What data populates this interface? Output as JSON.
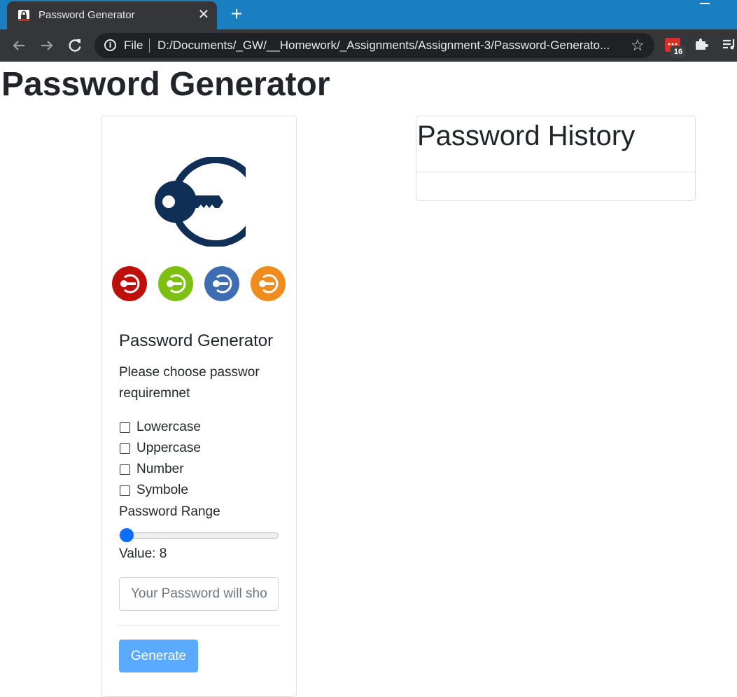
{
  "browser": {
    "tab_title": "Password Generator",
    "tab_close": "✕",
    "new_tab": "+",
    "scheme": "File",
    "url": "D:/Documents/_GW/__Homework/_Assignments/Assignment-3/Password-Generato...",
    "extension_badge": "16"
  },
  "page": {
    "title": "Password Generator"
  },
  "generator": {
    "heading": "Password Generator",
    "description": "Please choose passwor requiremnet",
    "options": [
      {
        "label": "Lowercase",
        "checked": false
      },
      {
        "label": "Uppercase",
        "checked": false
      },
      {
        "label": "Number",
        "checked": false
      },
      {
        "label": "Symbole",
        "checked": false
      }
    ],
    "range_label": "Password Range",
    "range_value_fraction": 0,
    "value_line": "Value: 8",
    "password_placeholder": "Your Password will show here",
    "generate_label": "Generate",
    "key_icon_colors": [
      "#bf0f0b",
      "#7dc012",
      "#3e6db2",
      "#f08c1d"
    ],
    "logo_color": "#0f2f57"
  },
  "history": {
    "title": "Password History",
    "items": []
  }
}
